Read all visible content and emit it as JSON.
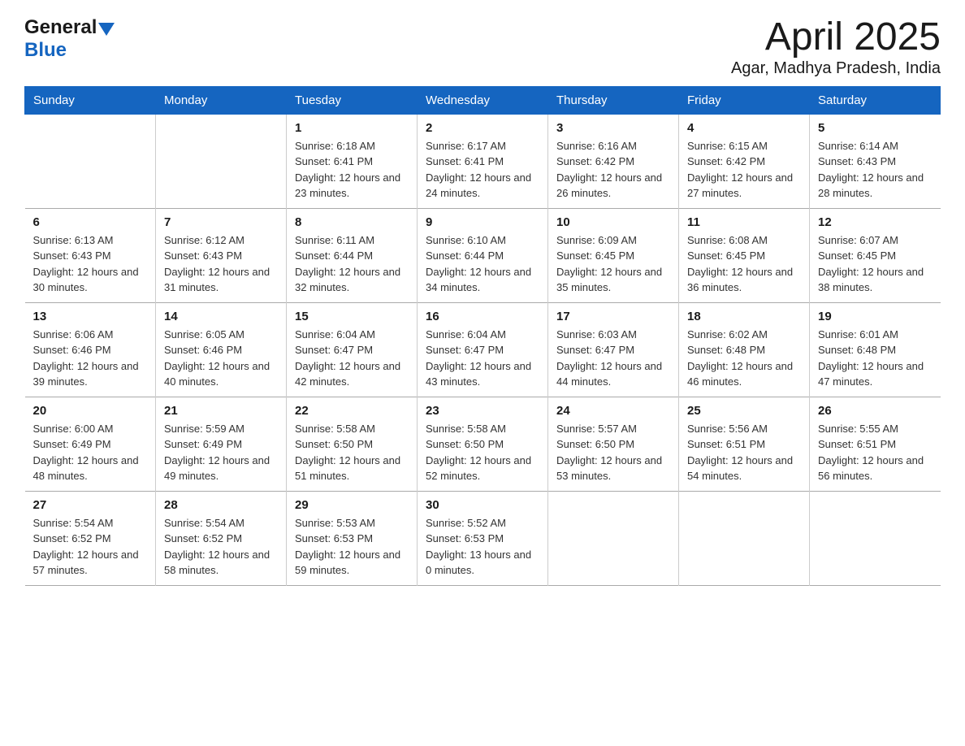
{
  "header": {
    "title": "April 2025",
    "subtitle": "Agar, Madhya Pradesh, India",
    "logo_general": "General",
    "logo_blue": "Blue"
  },
  "days_of_week": [
    "Sunday",
    "Monday",
    "Tuesday",
    "Wednesday",
    "Thursday",
    "Friday",
    "Saturday"
  ],
  "weeks": [
    [
      {
        "day": "",
        "sunrise": "",
        "sunset": "",
        "daylight": ""
      },
      {
        "day": "",
        "sunrise": "",
        "sunset": "",
        "daylight": ""
      },
      {
        "day": "1",
        "sunrise": "Sunrise: 6:18 AM",
        "sunset": "Sunset: 6:41 PM",
        "daylight": "Daylight: 12 hours and 23 minutes."
      },
      {
        "day": "2",
        "sunrise": "Sunrise: 6:17 AM",
        "sunset": "Sunset: 6:41 PM",
        "daylight": "Daylight: 12 hours and 24 minutes."
      },
      {
        "day": "3",
        "sunrise": "Sunrise: 6:16 AM",
        "sunset": "Sunset: 6:42 PM",
        "daylight": "Daylight: 12 hours and 26 minutes."
      },
      {
        "day": "4",
        "sunrise": "Sunrise: 6:15 AM",
        "sunset": "Sunset: 6:42 PM",
        "daylight": "Daylight: 12 hours and 27 minutes."
      },
      {
        "day": "5",
        "sunrise": "Sunrise: 6:14 AM",
        "sunset": "Sunset: 6:43 PM",
        "daylight": "Daylight: 12 hours and 28 minutes."
      }
    ],
    [
      {
        "day": "6",
        "sunrise": "Sunrise: 6:13 AM",
        "sunset": "Sunset: 6:43 PM",
        "daylight": "Daylight: 12 hours and 30 minutes."
      },
      {
        "day": "7",
        "sunrise": "Sunrise: 6:12 AM",
        "sunset": "Sunset: 6:43 PM",
        "daylight": "Daylight: 12 hours and 31 minutes."
      },
      {
        "day": "8",
        "sunrise": "Sunrise: 6:11 AM",
        "sunset": "Sunset: 6:44 PM",
        "daylight": "Daylight: 12 hours and 32 minutes."
      },
      {
        "day": "9",
        "sunrise": "Sunrise: 6:10 AM",
        "sunset": "Sunset: 6:44 PM",
        "daylight": "Daylight: 12 hours and 34 minutes."
      },
      {
        "day": "10",
        "sunrise": "Sunrise: 6:09 AM",
        "sunset": "Sunset: 6:45 PM",
        "daylight": "Daylight: 12 hours and 35 minutes."
      },
      {
        "day": "11",
        "sunrise": "Sunrise: 6:08 AM",
        "sunset": "Sunset: 6:45 PM",
        "daylight": "Daylight: 12 hours and 36 minutes."
      },
      {
        "day": "12",
        "sunrise": "Sunrise: 6:07 AM",
        "sunset": "Sunset: 6:45 PM",
        "daylight": "Daylight: 12 hours and 38 minutes."
      }
    ],
    [
      {
        "day": "13",
        "sunrise": "Sunrise: 6:06 AM",
        "sunset": "Sunset: 6:46 PM",
        "daylight": "Daylight: 12 hours and 39 minutes."
      },
      {
        "day": "14",
        "sunrise": "Sunrise: 6:05 AM",
        "sunset": "Sunset: 6:46 PM",
        "daylight": "Daylight: 12 hours and 40 minutes."
      },
      {
        "day": "15",
        "sunrise": "Sunrise: 6:04 AM",
        "sunset": "Sunset: 6:47 PM",
        "daylight": "Daylight: 12 hours and 42 minutes."
      },
      {
        "day": "16",
        "sunrise": "Sunrise: 6:04 AM",
        "sunset": "Sunset: 6:47 PM",
        "daylight": "Daylight: 12 hours and 43 minutes."
      },
      {
        "day": "17",
        "sunrise": "Sunrise: 6:03 AM",
        "sunset": "Sunset: 6:47 PM",
        "daylight": "Daylight: 12 hours and 44 minutes."
      },
      {
        "day": "18",
        "sunrise": "Sunrise: 6:02 AM",
        "sunset": "Sunset: 6:48 PM",
        "daylight": "Daylight: 12 hours and 46 minutes."
      },
      {
        "day": "19",
        "sunrise": "Sunrise: 6:01 AM",
        "sunset": "Sunset: 6:48 PM",
        "daylight": "Daylight: 12 hours and 47 minutes."
      }
    ],
    [
      {
        "day": "20",
        "sunrise": "Sunrise: 6:00 AM",
        "sunset": "Sunset: 6:49 PM",
        "daylight": "Daylight: 12 hours and 48 minutes."
      },
      {
        "day": "21",
        "sunrise": "Sunrise: 5:59 AM",
        "sunset": "Sunset: 6:49 PM",
        "daylight": "Daylight: 12 hours and 49 minutes."
      },
      {
        "day": "22",
        "sunrise": "Sunrise: 5:58 AM",
        "sunset": "Sunset: 6:50 PM",
        "daylight": "Daylight: 12 hours and 51 minutes."
      },
      {
        "day": "23",
        "sunrise": "Sunrise: 5:58 AM",
        "sunset": "Sunset: 6:50 PM",
        "daylight": "Daylight: 12 hours and 52 minutes."
      },
      {
        "day": "24",
        "sunrise": "Sunrise: 5:57 AM",
        "sunset": "Sunset: 6:50 PM",
        "daylight": "Daylight: 12 hours and 53 minutes."
      },
      {
        "day": "25",
        "sunrise": "Sunrise: 5:56 AM",
        "sunset": "Sunset: 6:51 PM",
        "daylight": "Daylight: 12 hours and 54 minutes."
      },
      {
        "day": "26",
        "sunrise": "Sunrise: 5:55 AM",
        "sunset": "Sunset: 6:51 PM",
        "daylight": "Daylight: 12 hours and 56 minutes."
      }
    ],
    [
      {
        "day": "27",
        "sunrise": "Sunrise: 5:54 AM",
        "sunset": "Sunset: 6:52 PM",
        "daylight": "Daylight: 12 hours and 57 minutes."
      },
      {
        "day": "28",
        "sunrise": "Sunrise: 5:54 AM",
        "sunset": "Sunset: 6:52 PM",
        "daylight": "Daylight: 12 hours and 58 minutes."
      },
      {
        "day": "29",
        "sunrise": "Sunrise: 5:53 AM",
        "sunset": "Sunset: 6:53 PM",
        "daylight": "Daylight: 12 hours and 59 minutes."
      },
      {
        "day": "30",
        "sunrise": "Sunrise: 5:52 AM",
        "sunset": "Sunset: 6:53 PM",
        "daylight": "Daylight: 13 hours and 0 minutes."
      },
      {
        "day": "",
        "sunrise": "",
        "sunset": "",
        "daylight": ""
      },
      {
        "day": "",
        "sunrise": "",
        "sunset": "",
        "daylight": ""
      },
      {
        "day": "",
        "sunrise": "",
        "sunset": "",
        "daylight": ""
      }
    ]
  ]
}
